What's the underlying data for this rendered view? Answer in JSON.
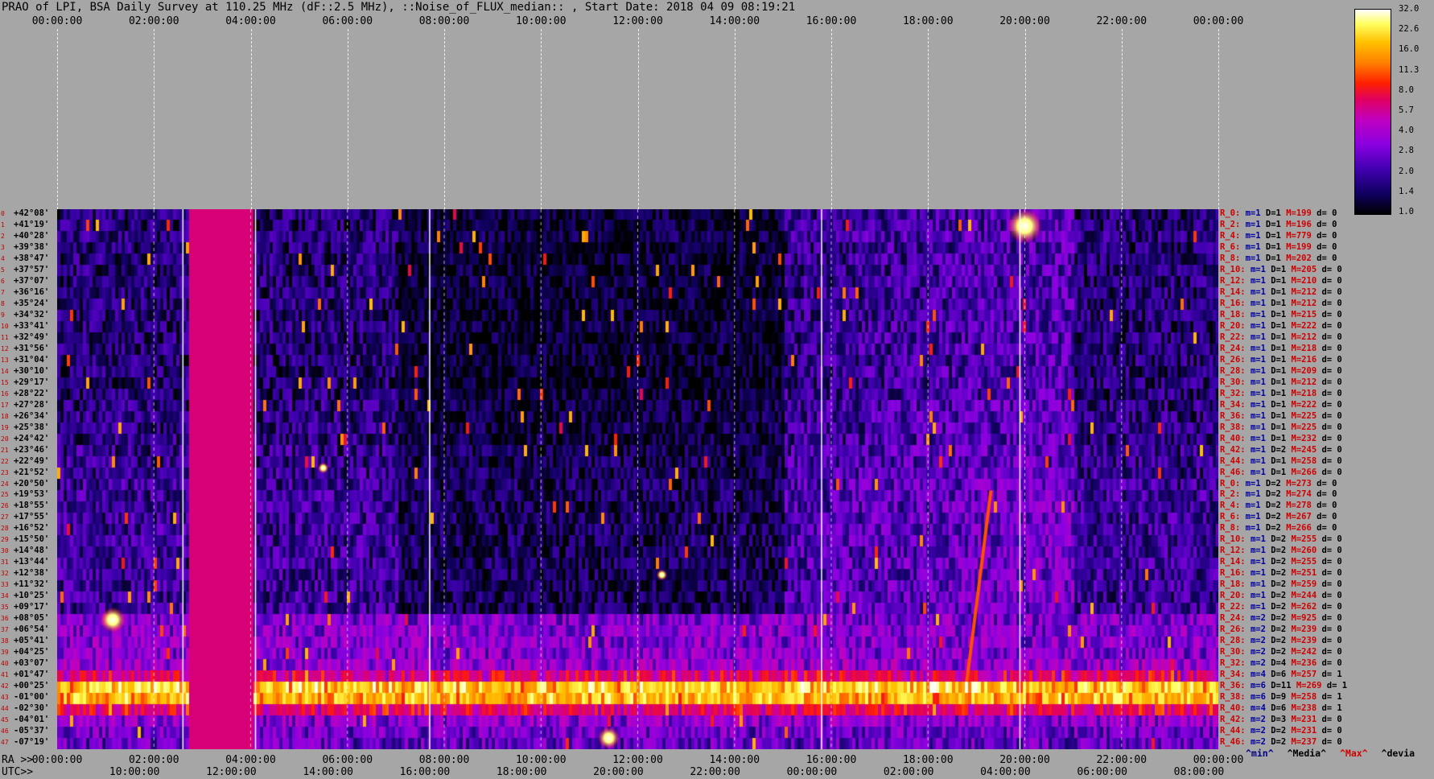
{
  "title": "PRAO of LPI, BSA Daily Survey at 110.25 MHz (dF::2.5 MHz), ::Noise_of_FLUX_median:: , Start Date: 2018 04 09 08:19:21",
  "axes": {
    "top_ticks": [
      "00:00:00",
      "02:00:00",
      "04:00:00",
      "06:00:00",
      "08:00:00",
      "10:00:00",
      "12:00:00",
      "14:00:00",
      "16:00:00",
      "18:00:00",
      "20:00:00",
      "22:00:00",
      "00:00:00"
    ],
    "ra_label": "RA >>",
    "ra_ticks": [
      "00:00:00",
      "02:00:00",
      "04:00:00",
      "06:00:00",
      "08:00:00",
      "10:00:00",
      "12:00:00",
      "14:00:00",
      "16:00:00",
      "18:00:00",
      "20:00:00",
      "22:00:00",
      "00:00:00"
    ],
    "utc_label": "UTC>>",
    "utc_ticks": [
      "10:00:00",
      "12:00:00",
      "14:00:00",
      "16:00:00",
      "18:00:00",
      "20:00:00",
      "22:00:00",
      "00:00:00",
      "02:00:00",
      "04:00:00",
      "06:00:00",
      "08:00:00"
    ]
  },
  "colorbar": {
    "ticks": [
      "32.0",
      "22.6",
      "16.0",
      "11.3",
      "8.0",
      "5.7",
      "4.0",
      "2.8",
      "2.0",
      "1.4",
      "1.0"
    ],
    "colors": [
      "#000000",
      "#100060",
      "#4000b0",
      "#8a00e0",
      "#c000c0",
      "#e00060",
      "#ff2000",
      "#ff8000",
      "#ffc000",
      "#ffff60",
      "#ffffff"
    ]
  },
  "chart_data": {
    "type": "heatmap",
    "title": "PRAO of LPI, BSA Daily Survey at 110.25 MHz (dF::2.5 MHz), ::Noise_of_FLUX_median:: , Start Date: 2018 04 09 08:19:21",
    "x_ra_hours_range": [
      0,
      24
    ],
    "color_scale": "log",
    "color_range": [
      1.0,
      32.0
    ],
    "declinations": [
      "+42°08'",
      "+41°19'",
      "+40°28'",
      "+39°38'",
      "+38°47'",
      "+37°57'",
      "+37°07'",
      "+36°16'",
      "+35°24'",
      "+34°32'",
      "+33°41'",
      "+32°49'",
      "+31°56'",
      "+31°04'",
      "+30°10'",
      "+29°17'",
      "+28°22'",
      "+27°28'",
      "+26°34'",
      "+25°38'",
      "+24°42'",
      "+23°46'",
      "+22°49'",
      "+21°52'",
      "+20°50'",
      "+19°53'",
      "+18°55'",
      "+17°55'",
      "+16°52'",
      "+15°50'",
      "+14°48'",
      "+13°44'",
      "+12°38'",
      "+11°32'",
      "+10°25'",
      "+09°17'",
      "+08°05'",
      "+06°54'",
      "+05°41'",
      "+04°25'",
      "+03°07'",
      "+01°47'",
      "+00°25'",
      "-01°00'",
      "-02°30'",
      "-04°01'",
      "-05°37'",
      "-07°19'"
    ],
    "row_index": [
      0,
      1,
      2,
      3,
      4,
      5,
      6,
      7,
      8,
      9,
      10,
      11,
      12,
      13,
      14,
      15,
      16,
      17,
      18,
      19,
      20,
      21,
      22,
      23,
      24,
      25,
      26,
      27,
      28,
      29,
      30,
      31,
      32,
      33,
      34,
      35,
      36,
      37,
      38,
      39,
      40,
      41,
      42,
      43,
      44,
      45,
      46,
      47
    ],
    "rows": [
      {
        "r": "R_0:",
        "m": "m=1",
        "d": "D=1",
        "M": "M=199",
        "dv": "d= 0"
      },
      {
        "r": "R_2:",
        "m": "m=1",
        "d": "D=1",
        "M": "M=196",
        "dv": "d= 0"
      },
      {
        "r": "R_4:",
        "m": "m=1",
        "d": "D=1",
        "M": "M=779",
        "dv": "d= 0"
      },
      {
        "r": "R_6:",
        "m": "m=1",
        "d": "D=1",
        "M": "M=199",
        "dv": "d= 0"
      },
      {
        "r": "R_8:",
        "m": "m=1",
        "d": "D=1",
        "M": "M=202",
        "dv": "d= 0"
      },
      {
        "r": "R_10:",
        "m": "m=1",
        "d": "D=1",
        "M": "M=205",
        "dv": "d= 0"
      },
      {
        "r": "R_12:",
        "m": "m=1",
        "d": "D=1",
        "M": "M=210",
        "dv": "d= 0"
      },
      {
        "r": "R_14:",
        "m": "m=1",
        "d": "D=1",
        "M": "M=212",
        "dv": "d= 0"
      },
      {
        "r": "R_16:",
        "m": "m=1",
        "d": "D=1",
        "M": "M=212",
        "dv": "d= 0"
      },
      {
        "r": "R_18:",
        "m": "m=1",
        "d": "D=1",
        "M": "M=215",
        "dv": "d= 0"
      },
      {
        "r": "R_20:",
        "m": "m=1",
        "d": "D=1",
        "M": "M=222",
        "dv": "d= 0"
      },
      {
        "r": "R_22:",
        "m": "m=1",
        "d": "D=1",
        "M": "M=212",
        "dv": "d= 0"
      },
      {
        "r": "R_24:",
        "m": "m=1",
        "d": "D=1",
        "M": "M=218",
        "dv": "d= 0"
      },
      {
        "r": "R_26:",
        "m": "m=1",
        "d": "D=1",
        "M": "M=216",
        "dv": "d= 0"
      },
      {
        "r": "R_28:",
        "m": "m=1",
        "d": "D=1",
        "M": "M=209",
        "dv": "d= 0"
      },
      {
        "r": "R_30:",
        "m": "m=1",
        "d": "D=1",
        "M": "M=212",
        "dv": "d= 0"
      },
      {
        "r": "R_32:",
        "m": "m=1",
        "d": "D=1",
        "M": "M=218",
        "dv": "d= 0"
      },
      {
        "r": "R_34:",
        "m": "m=1",
        "d": "D=1",
        "M": "M=222",
        "dv": "d= 0"
      },
      {
        "r": "R_36:",
        "m": "m=1",
        "d": "D=1",
        "M": "M=225",
        "dv": "d= 0"
      },
      {
        "r": "R_38:",
        "m": "m=1",
        "d": "D=1",
        "M": "M=225",
        "dv": "d= 0"
      },
      {
        "r": "R_40:",
        "m": "m=1",
        "d": "D=1",
        "M": "M=232",
        "dv": "d= 0"
      },
      {
        "r": "R_42:",
        "m": "m=1",
        "d": "D=2",
        "M": "M=245",
        "dv": "d= 0"
      },
      {
        "r": "R_44:",
        "m": "m=1",
        "d": "D=1",
        "M": "M=258",
        "dv": "d= 0"
      },
      {
        "r": "R_46:",
        "m": "m=1",
        "d": "D=1",
        "M": "M=266",
        "dv": "d= 0"
      },
      {
        "r": "R_0:",
        "m": "m=1",
        "d": "D=2",
        "M": "M=273",
        "dv": "d= 0"
      },
      {
        "r": "R_2:",
        "m": "m=1",
        "d": "D=2",
        "M": "M=274",
        "dv": "d= 0"
      },
      {
        "r": "R_4:",
        "m": "m=1",
        "d": "D=2",
        "M": "M=278",
        "dv": "d= 0"
      },
      {
        "r": "R_6:",
        "m": "m=1",
        "d": "D=2",
        "M": "M=267",
        "dv": "d= 0"
      },
      {
        "r": "R_8:",
        "m": "m=1",
        "d": "D=2",
        "M": "M=266",
        "dv": "d= 0"
      },
      {
        "r": "R_10:",
        "m": "m=1",
        "d": "D=2",
        "M": "M=255",
        "dv": "d= 0"
      },
      {
        "r": "R_12:",
        "m": "m=1",
        "d": "D=2",
        "M": "M=260",
        "dv": "d= 0"
      },
      {
        "r": "R_14:",
        "m": "m=1",
        "d": "D=2",
        "M": "M=255",
        "dv": "d= 0"
      },
      {
        "r": "R_16:",
        "m": "m=1",
        "d": "D=2",
        "M": "M=251",
        "dv": "d= 0"
      },
      {
        "r": "R_18:",
        "m": "m=1",
        "d": "D=2",
        "M": "M=259",
        "dv": "d= 0"
      },
      {
        "r": "R_20:",
        "m": "m=1",
        "d": "D=2",
        "M": "M=244",
        "dv": "d= 0"
      },
      {
        "r": "R_22:",
        "m": "m=1",
        "d": "D=2",
        "M": "M=262",
        "dv": "d= 0"
      },
      {
        "r": "R_24:",
        "m": "m=2",
        "d": "D=2",
        "M": "M=925",
        "dv": "d= 0"
      },
      {
        "r": "R_26:",
        "m": "m=2",
        "d": "D=2",
        "M": "M=239",
        "dv": "d= 0"
      },
      {
        "r": "R_28:",
        "m": "m=2",
        "d": "D=2",
        "M": "M=239",
        "dv": "d= 0"
      },
      {
        "r": "R_30:",
        "m": "m=2",
        "d": "D=2",
        "M": "M=242",
        "dv": "d= 0"
      },
      {
        "r": "R_32:",
        "m": "m=2",
        "d": "D=4",
        "M": "M=236",
        "dv": "d= 0"
      },
      {
        "r": "R_34:",
        "m": "m=4",
        "d": "D=6",
        "M": "M=257",
        "dv": "d= 1"
      },
      {
        "r": "R_36:",
        "m": "m=6",
        "d": "D=11",
        "M": "M=269",
        "dv": "d= 1"
      },
      {
        "r": "R_38:",
        "m": "m=6",
        "d": "D=9",
        "M": "M=258",
        "dv": "d= 1"
      },
      {
        "r": "R_40:",
        "m": "m=4",
        "d": "D=6",
        "M": "M=238",
        "dv": "d= 1"
      },
      {
        "r": "R_42:",
        "m": "m=2",
        "d": "D=3",
        "M": "M=231",
        "dv": "d= 0"
      },
      {
        "r": "R_44:",
        "m": "m=2",
        "d": "D=2",
        "M": "M=231",
        "dv": "d= 0"
      },
      {
        "r": "R_46:",
        "m": "m=2",
        "d": "D=2",
        "M": "M=237",
        "dv": "d= 0"
      }
    ],
    "row_level": [
      1.6,
      1.6,
      1.7,
      1.6,
      1.6,
      1.6,
      1.6,
      1.6,
      1.6,
      1.6,
      1.6,
      1.6,
      1.6,
      1.6,
      1.6,
      1.6,
      1.6,
      1.7,
      1.7,
      1.7,
      1.7,
      1.8,
      1.8,
      1.8,
      1.9,
      1.9,
      1.9,
      1.9,
      1.9,
      1.9,
      1.9,
      1.9,
      1.9,
      1.9,
      1.9,
      1.9,
      2.8,
      2.8,
      2.9,
      2.9,
      3.2,
      5.5,
      18,
      16,
      6,
      3,
      2.6,
      2.4
    ],
    "legend": [
      "^min^",
      "^Media^",
      "^Max^",
      "^devia"
    ]
  }
}
